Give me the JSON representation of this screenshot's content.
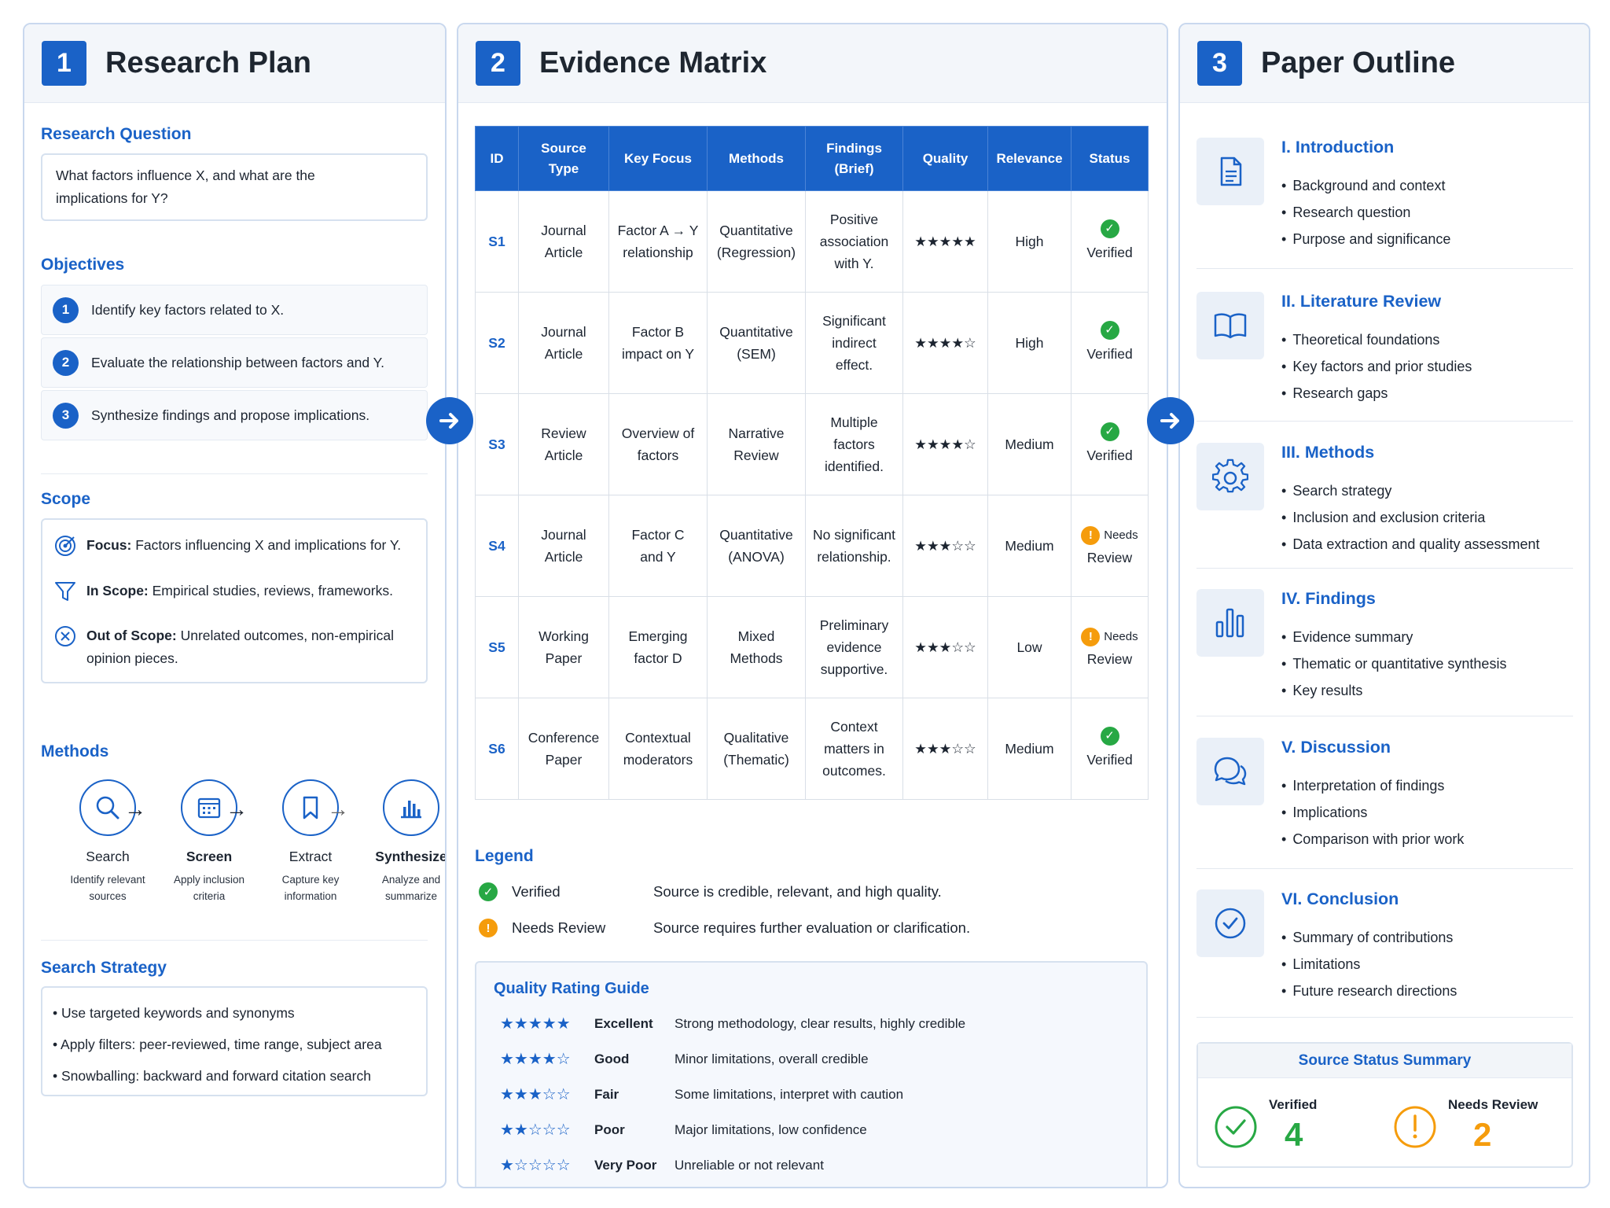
{
  "panel1": {
    "num": "1",
    "title": "Research Plan",
    "rq_title": "Research Question",
    "rq_text_1": "What factors influence X, and what are the",
    "rq_text_2": "implications for Y?",
    "obj_title": "Objectives",
    "objectives": [
      {
        "num": "1",
        "text": "Identify key factors related to X."
      },
      {
        "num": "2",
        "text": "Evaluate the relationship between factors and Y."
      },
      {
        "num": "3",
        "text": "Synthesize findings and propose implications."
      }
    ],
    "scope_title": "Scope",
    "scope": [
      {
        "label": "Focus:",
        "text": " Factors influencing X and implications for Y."
      },
      {
        "label": "In Scope:",
        "text": " Empirical studies, reviews, frameworks."
      },
      {
        "label": "Out of Scope:",
        "text": " Unrelated outcomes, non-empirical",
        "text2": "opinion pieces."
      }
    ],
    "methods_title": "Methods",
    "methods": [
      {
        "label": "Search",
        "desc1": "Identify relevant",
        "desc2": "sources",
        "icon": "search-icon"
      },
      {
        "label": "Screen",
        "desc1": "Apply inclusion",
        "desc2": "criteria",
        "icon": "calendar-grid-icon"
      },
      {
        "label": "Extract",
        "desc1": "Capture key",
        "desc2": "information",
        "icon": "bookmark-icon"
      },
      {
        "label": "Synthesize",
        "desc1": "Analyze and",
        "desc2": "summarize",
        "icon": "bar-chart-icon"
      }
    ],
    "ss_title": "Search Strategy",
    "search_strategy": [
      "Use targeted keywords and synonyms",
      "Apply filters: peer-reviewed, time range, subject area",
      "Snowballing: backward and forward citation search"
    ]
  },
  "panel2": {
    "num": "2",
    "title": "Evidence Matrix",
    "headers": [
      "ID",
      "Source Type",
      "Key Focus",
      "Methods",
      "Findings (Brief)",
      "Quality",
      "Relevance",
      "Status"
    ],
    "rows": [
      {
        "id": "S1",
        "type1": "Journal",
        "type2": "Article",
        "focus1": "Factor A → Y",
        "focus2": "relationship",
        "m1": "Quantitative",
        "m2": "(Regression)",
        "f1": "Positive",
        "f2": "association",
        "f3": "with Y.",
        "stars": "★★★★★",
        "relevance": "High",
        "status": "Verified",
        "status_kind": "ok"
      },
      {
        "id": "S2",
        "type1": "Journal",
        "type2": "Article",
        "focus1": "Factor B",
        "focus2": "impact on Y",
        "m1": "Quantitative",
        "m2": "(SEM)",
        "f1": "Significant",
        "f2": "indirect",
        "f3": "effect.",
        "stars": "★★★★☆",
        "relevance": "High",
        "status": "Verified",
        "status_kind": "ok"
      },
      {
        "id": "S3",
        "type1": "Review",
        "type2": "Article",
        "focus1": "Overview of",
        "focus2": "factors",
        "m1": "Narrative",
        "m2": "Review",
        "f1": "Multiple",
        "f2": "factors",
        "f3": "identified.",
        "stars": "★★★★☆",
        "relevance": "Medium",
        "status": "Verified",
        "status_kind": "ok"
      },
      {
        "id": "S4",
        "type1": "Journal",
        "type2": "Article",
        "focus1": "Factor C",
        "focus2": "and Y",
        "m1": "Quantitative",
        "m2": "(ANOVA)",
        "f1": "No significant",
        "f2": "relationship.",
        "f3": "",
        "stars": "★★★☆☆",
        "relevance": "Medium",
        "status_a": "Needs",
        "status_b": "Review",
        "status_kind": "warn"
      },
      {
        "id": "S5",
        "type1": "Working",
        "type2": "Paper",
        "focus1": "Emerging",
        "focus2": "factor D",
        "m1": "Mixed",
        "m2": "Methods",
        "f1": "Preliminary",
        "f2": "evidence",
        "f3": "supportive.",
        "stars": "★★★☆☆",
        "relevance": "Low",
        "status_a": "Needs",
        "status_b": "Review",
        "status_kind": "warn"
      },
      {
        "id": "S6",
        "type1": "Conference",
        "type2": "Paper",
        "focus1": "Contextual",
        "focus2": "moderators",
        "m1": "Qualitative",
        "m2": "(Thematic)",
        "f1": "Context",
        "f2": "matters in",
        "f3": "outcomes.",
        "stars": "★★★☆☆",
        "relevance": "Medium",
        "status": "Verified",
        "status_kind": "ok"
      }
    ],
    "legend_title": "Legend",
    "legend": [
      {
        "label": "Verified",
        "desc": "Source is credible, relevant, and high quality."
      },
      {
        "label": "Needs Review",
        "desc": "Source requires further evaluation or clarification."
      }
    ],
    "qg_title": "Quality Rating Guide",
    "quality_guide": [
      {
        "stars": "★★★★★",
        "name": "Excellent",
        "desc": "Strong methodology, clear results, highly credible"
      },
      {
        "stars": "★★★★☆",
        "name": "Good",
        "desc": "Minor limitations, overall credible"
      },
      {
        "stars": "★★★☆☆",
        "name": "Fair",
        "desc": "Some limitations, interpret with caution"
      },
      {
        "stars": "★★☆☆☆",
        "name": "Poor",
        "desc": "Major limitations, low confidence"
      },
      {
        "stars": "★☆☆☆☆",
        "name": "Very Poor",
        "desc": "Unreliable or not relevant"
      }
    ]
  },
  "panel3": {
    "num": "3",
    "title": "Paper Outline",
    "sections": [
      {
        "title": "I. Introduction",
        "icon": "document-icon",
        "items": [
          "Background and context",
          "Research question",
          "Purpose and significance"
        ]
      },
      {
        "title": "II. Literature Review",
        "icon": "open-book-icon",
        "items": [
          "Theoretical foundations",
          "Key factors and prior studies",
          "Research gaps"
        ]
      },
      {
        "title": "III. Methods",
        "icon": "gear-icon",
        "items": [
          "Search strategy",
          "Inclusion and exclusion criteria",
          "Data extraction and quality assessment"
        ]
      },
      {
        "title": "IV. Findings",
        "icon": "bar-chart-icon",
        "items": [
          "Evidence summary",
          "Thematic or quantitative synthesis",
          "Key results"
        ]
      },
      {
        "title": "V. Discussion",
        "icon": "chat-bubbles-icon",
        "items": [
          "Interpretation of findings",
          "Implications",
          "Comparison with prior work"
        ]
      },
      {
        "title": "VI. Conclusion",
        "icon": "check-circle-icon",
        "items": [
          "Summary of contributions",
          "Limitations",
          "Future research directions"
        ]
      }
    ],
    "summary_title": "Source Status Summary",
    "verified_label": "Verified",
    "verified_count": "4",
    "review_label": "Needs Review",
    "review_count": "2"
  },
  "colors": {
    "accent": "#1a62c7",
    "ok": "#27a844",
    "warn": "#f59c0c"
  }
}
